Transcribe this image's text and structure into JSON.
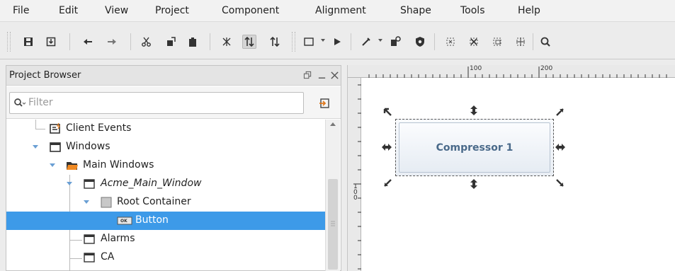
{
  "menu": {
    "items": [
      "File",
      "Edit",
      "View",
      "Project",
      "Component",
      "Alignment",
      "Shape",
      "Tools",
      "Help"
    ]
  },
  "toolbar": {
    "icons": [
      "save-icon",
      "save-all-icon",
      "undo-icon",
      "redo-icon",
      "cut-icon",
      "copy-icon",
      "paste-icon",
      "group-icon",
      "order-icon",
      "order-2-icon",
      "window-icon",
      "play-icon",
      "wrench-icon",
      "script-icon",
      "shield-icon",
      "bounds-icon",
      "bounds-2-icon",
      "bounds-3-icon",
      "bounds-4-icon",
      "zoom-icon"
    ]
  },
  "project_browser": {
    "title": "Project Browser",
    "filter_placeholder": "Filter",
    "tree": [
      {
        "label": "Client Events",
        "italic": false,
        "selected": false
      },
      {
        "label": "Windows",
        "italic": false,
        "selected": false
      },
      {
        "label": "Main Windows",
        "italic": false,
        "selected": false
      },
      {
        "label": "Acme_Main_Window",
        "italic": true,
        "selected": false
      },
      {
        "label": "Root Container",
        "italic": false,
        "selected": false
      },
      {
        "label": "Button",
        "italic": false,
        "selected": true
      },
      {
        "label": "Alarms",
        "italic": false,
        "selected": false
      },
      {
        "label": "CA",
        "italic": false,
        "selected": false
      }
    ],
    "button_badge": "OK"
  },
  "designer": {
    "ruler_top_labels": [
      "100",
      "200"
    ],
    "ruler_left_label": "100",
    "component_label": "Compressor 1"
  }
}
